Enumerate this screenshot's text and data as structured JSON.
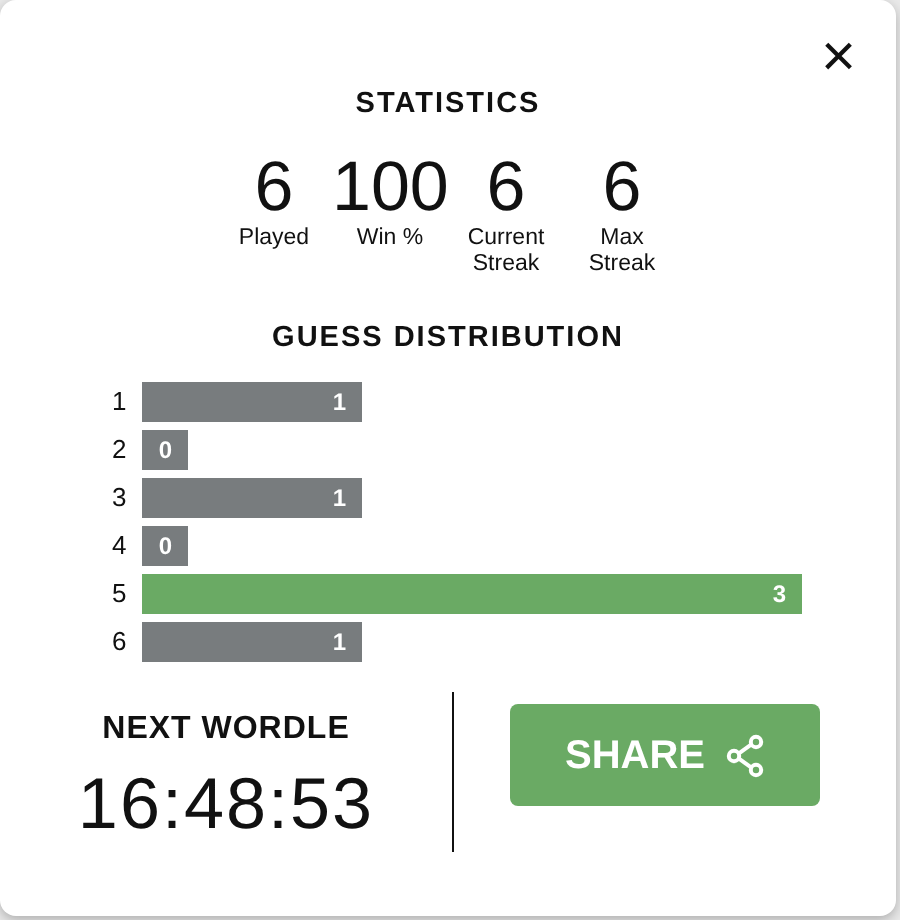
{
  "close_button": {
    "label": "×"
  },
  "title": "STATISTICS",
  "stats": [
    {
      "value": "6",
      "label": "Played"
    },
    {
      "value": "100",
      "label": "Win %"
    },
    {
      "value": "6",
      "label": "Current Streak"
    },
    {
      "value": "6",
      "label": "Max Streak"
    }
  ],
  "distribution": {
    "title": "GUESS DISTRIBUTION",
    "rows": [
      {
        "guess": "1",
        "count": "1",
        "selected": false
      },
      {
        "guess": "2",
        "count": "0",
        "selected": false
      },
      {
        "guess": "3",
        "count": "1",
        "selected": false
      },
      {
        "guess": "4",
        "count": "0",
        "selected": false
      },
      {
        "guess": "5",
        "count": "3",
        "selected": true
      },
      {
        "guess": "6",
        "count": "1",
        "selected": false
      }
    ]
  },
  "next": {
    "label": "NEXT WORDLE",
    "timer": "16:48:53"
  },
  "share_button": {
    "label": "SHARE"
  }
}
